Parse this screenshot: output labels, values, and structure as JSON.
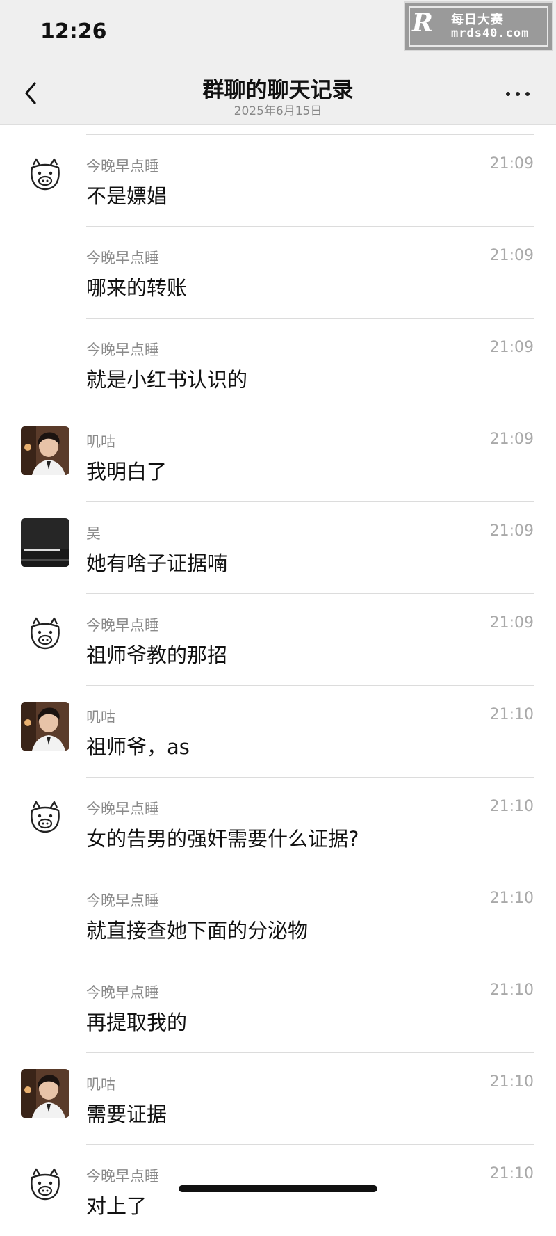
{
  "status": {
    "time": "12:26"
  },
  "watermark": {
    "logo": "R",
    "line1": "每日大赛",
    "line2": "mrds40.com"
  },
  "nav": {
    "title": "群聊的聊天记录",
    "subtitle": "2025年6月15日"
  },
  "icons": {
    "back": "chevron-left-icon",
    "more": "more-dots-icon"
  },
  "messages": [
    {
      "sender": "今晚早点睡",
      "time": "21:09",
      "text": "不是嫖娼",
      "avatar": "pig-doodle"
    },
    {
      "sender": "今晚早点睡",
      "time": "21:09",
      "text": "哪来的转账",
      "avatar": ""
    },
    {
      "sender": "今晚早点睡",
      "time": "21:09",
      "text": "就是小红书认识的",
      "avatar": ""
    },
    {
      "sender": "叽咕",
      "time": "21:09",
      "text": "我明白了",
      "avatar": "photo-man"
    },
    {
      "sender": "吴",
      "time": "21:09",
      "text": "她有啥子证据喃",
      "avatar": "dark-photo"
    },
    {
      "sender": "今晚早点睡",
      "time": "21:09",
      "text": "祖师爷教的那招",
      "avatar": "pig-doodle"
    },
    {
      "sender": "叽咕",
      "time": "21:10",
      "text": "祖师爷，as",
      "avatar": "photo-man"
    },
    {
      "sender": "今晚早点睡",
      "time": "21:10",
      "text": "女的告男的强奸需要什么证据?",
      "avatar": "pig-doodle"
    },
    {
      "sender": "今晚早点睡",
      "time": "21:10",
      "text": "就直接查她下面的分泌物",
      "avatar": ""
    },
    {
      "sender": "今晚早点睡",
      "time": "21:10",
      "text": "再提取我的",
      "avatar": ""
    },
    {
      "sender": "叽咕",
      "time": "21:10",
      "text": "需要证据",
      "avatar": "photo-man"
    },
    {
      "sender": "今晚早点睡",
      "time": "21:10",
      "text": "对上了",
      "avatar": "pig-doodle"
    }
  ]
}
